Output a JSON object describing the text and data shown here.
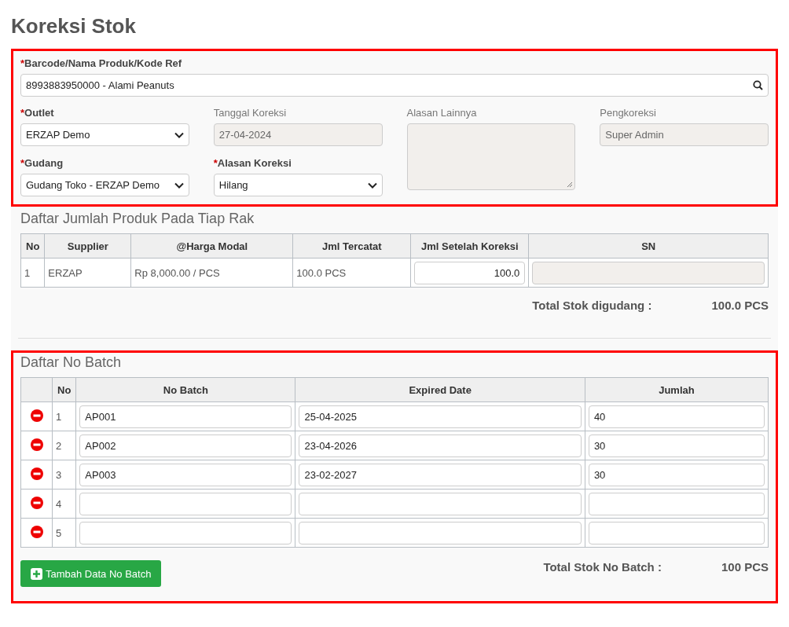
{
  "title": "Koreksi Stok",
  "form": {
    "highlighted": true,
    "product_field": {
      "required_mark": "*",
      "label": "Barcode/Nama Produk/Kode Ref",
      "value": "8993883950000 - Alami Peanuts"
    },
    "columns": [
      [
        {
          "kind": "select",
          "required_mark": "*",
          "label": "Outlet",
          "value": "ERZAP Demo",
          "disabled": false
        },
        {
          "kind": "select",
          "required_mark": "*",
          "label": "Gudang",
          "value": "Gudang Toko - ERZAP Demo",
          "disabled": false
        }
      ],
      [
        {
          "kind": "input",
          "label": "Tanggal Koreksi",
          "value": "27-04-2024",
          "disabled": true
        },
        {
          "kind": "select",
          "required_mark": "*",
          "label": "Alasan Koreksi",
          "value": "Hilang",
          "disabled": false
        }
      ],
      [
        {
          "kind": "textarea",
          "label": "Alasan Lainnya",
          "disabled": true
        }
      ],
      [
        {
          "kind": "input",
          "label": "Pengkoreksi",
          "value": "Super Admin",
          "disabled": true
        }
      ]
    ]
  },
  "rack_section": {
    "title": "Daftar Jumlah Produk Pada Tiap Rak",
    "columns": [
      "No",
      "Supplier",
      "@Harga Modal",
      "Jml Tercatat",
      "Jml Setelah Koreksi",
      "SN"
    ],
    "rows": [
      {
        "no": "1",
        "supplier": "ERZAP",
        "price": "Rp 8,000.00 / PCS",
        "recorded": "100.0 PCS",
        "after_correction": "100.0",
        "sn_disabled": true
      }
    ],
    "total_label": "Total Stok digudang :",
    "total_value": "100.0 PCS"
  },
  "batch_section": {
    "highlighted": true,
    "title": "Daftar No Batch",
    "columns": [
      "No",
      "No Batch",
      "Expired Date",
      "Jumlah"
    ],
    "rows": [
      {
        "no": "1",
        "batch": "AP001",
        "expired": "25-04-2025",
        "qty": "40"
      },
      {
        "no": "2",
        "batch": "AP002",
        "expired": "23-04-2026",
        "qty": "30"
      },
      {
        "no": "3",
        "batch": "AP003",
        "expired": "23-02-2027",
        "qty": "30"
      },
      {
        "no": "4"
      },
      {
        "no": "5"
      }
    ],
    "add_button": "Tambah Data No Batch",
    "total_label": "Total Stok No Batch :",
    "total_value": "100 PCS"
  }
}
